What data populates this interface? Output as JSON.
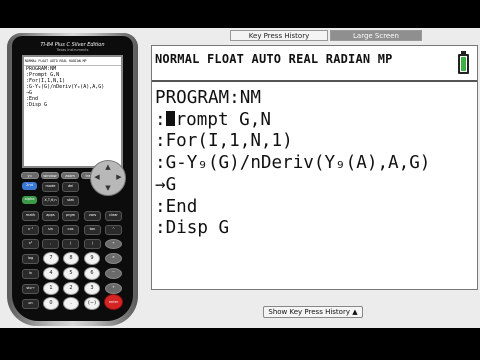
{
  "calculator": {
    "model": "TI-84 Plus C Silver Edition",
    "maker": "Texas Instruments",
    "mini_screen": {
      "status": "NORMAL FLOAT AUTO REAL RADIAN MP",
      "lines": [
        "PROGRAM:NM",
        ":Prompt G,N",
        ":For(I,1,N,1)",
        ":G-Y₉(G)/nDeriv(Y₉(A),A,G)",
        "→G",
        ":End",
        ":Disp G"
      ]
    },
    "keys": {
      "row1": [
        "y=",
        "window",
        "zoom",
        "trace",
        "graph"
      ],
      "row2": [
        "2nd",
        "mode",
        "del"
      ],
      "row3": [
        "alpha",
        "X,T,θ,n",
        "stat"
      ],
      "row4": [
        "math",
        "apps",
        "prgm",
        "vars",
        "clear"
      ],
      "row5": [
        "x⁻¹",
        "sin",
        "cos",
        "tan",
        "^"
      ],
      "row6": [
        "x²",
        ",",
        "(",
        ")",
        "÷"
      ],
      "row7": [
        "log",
        "7",
        "8",
        "9",
        "×"
      ],
      "row8": [
        "ln",
        "4",
        "5",
        "6",
        "−"
      ],
      "row9": [
        "sto→",
        "1",
        "2",
        "3",
        "+"
      ],
      "row10": [
        "on",
        "0",
        ".",
        "(−)",
        "enter"
      ]
    }
  },
  "tabs": {
    "key_press_history": "Key Press History",
    "large_screen": "Large Screen"
  },
  "screen": {
    "status_text": "NORMAL FLOAT AUTO REAL RADIAN MP",
    "battery_color": "#3cb043",
    "line1": "PROGRAM:NM",
    "line2_prefix": ":",
    "line2_rest": "rompt G,N",
    "line3": ":For(I,1,N,1)",
    "line4": ":G-Y₉(G)/nDeriv(Y₉(A),A,G)",
    "line5": "→G",
    "line6": ":End",
    "line7": ":Disp G"
  },
  "show_button": "Show Key Press History ▲"
}
